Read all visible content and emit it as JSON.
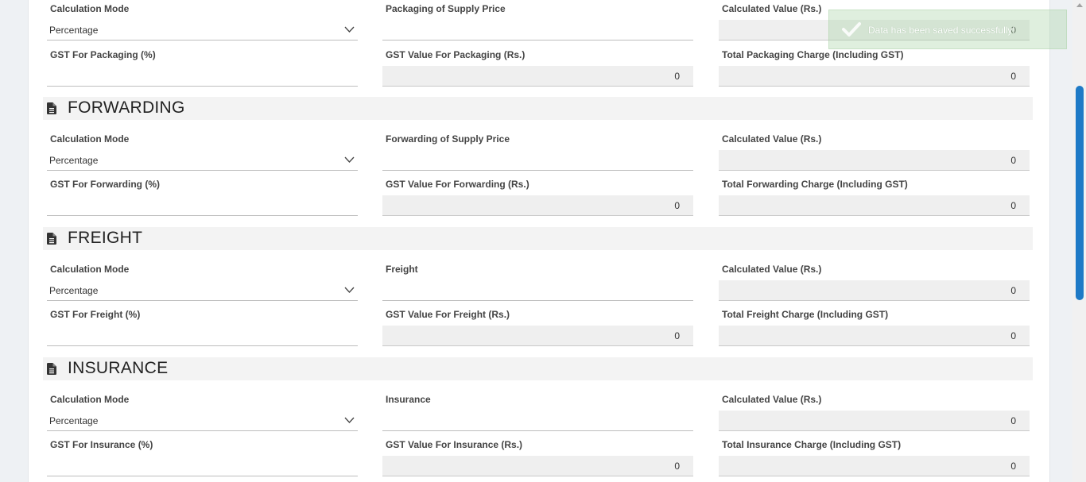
{
  "colors": {
    "accent": "#1e7ac6",
    "toast_bg": "#a4d0a0",
    "readonly_bg": "#efefef"
  },
  "packaging": {
    "calc_mode_label": "Calculation Mode",
    "calc_mode_value": "Percentage",
    "supply_price_label": "Packaging of Supply Price",
    "calculated_value_label": "Calculated Value (Rs.)",
    "calculated_value": "0",
    "gst_percent_label": "GST For Packaging (%)",
    "gst_value_label": "GST Value For Packaging (Rs.)",
    "gst_value": "0",
    "total_label": "Total Packaging Charge (Including GST)",
    "total_value": "0"
  },
  "forwarding": {
    "title": "FORWARDING",
    "icon": "document-icon",
    "calc_mode_label": "Calculation Mode",
    "calc_mode_value": "Percentage",
    "supply_price_label": "Forwarding of Supply Price",
    "calculated_value_label": "Calculated Value (Rs.)",
    "calculated_value": "0",
    "gst_percent_label": "GST For Forwarding (%)",
    "gst_value_label": "GST Value For Forwarding (Rs.)",
    "gst_value": "0",
    "total_label": "Total Forwarding Charge (Including GST)",
    "total_value": "0"
  },
  "freight": {
    "title": "FREIGHT",
    "icon": "document-icon",
    "calc_mode_label": "Calculation Mode",
    "calc_mode_value": "Percentage",
    "supply_price_label": "Freight",
    "calculated_value_label": "Calculated Value (Rs.)",
    "calculated_value": "0",
    "gst_percent_label": "GST For Freight (%)",
    "gst_value_label": "GST Value For Freight (Rs.)",
    "gst_value": "0",
    "total_label": "Total Freight Charge (Including GST)",
    "total_value": "0"
  },
  "insurance": {
    "title": "INSURANCE",
    "icon": "document-icon",
    "calc_mode_label": "Calculation Mode",
    "calc_mode_value": "Percentage",
    "supply_price_label": "Insurance",
    "calculated_value_label": "Calculated Value (Rs.)",
    "calculated_value": "0",
    "gst_percent_label": "GST For Insurance (%)",
    "gst_value_label": "GST Value For Insurance (Rs.)",
    "gst_value": "0",
    "total_label": "Total Insurance Charge (Including GST)",
    "total_value": "0"
  },
  "toast": {
    "message": "Data has been saved successfully!",
    "icon": "check-icon"
  }
}
